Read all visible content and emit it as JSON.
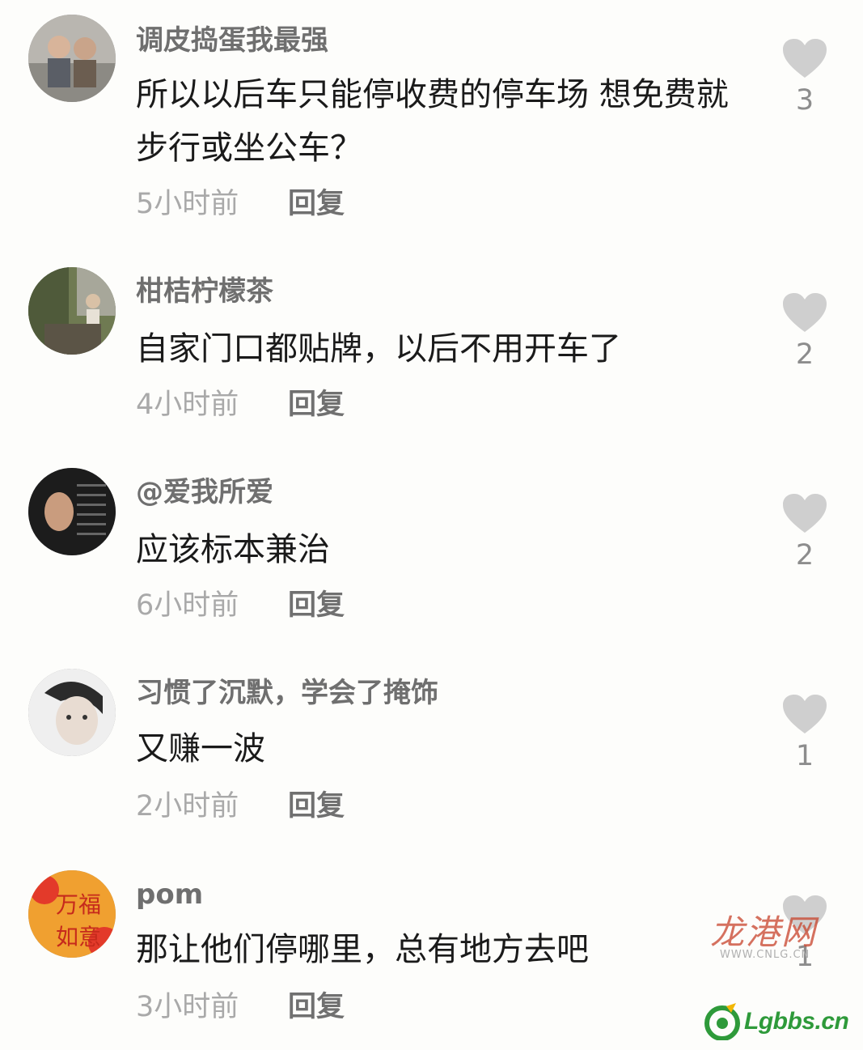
{
  "comments": [
    {
      "username": "调皮捣蛋我最强",
      "text": "所以以后车只能停收费的停车场 想免费就步行或坐公车？",
      "time": "5小时前",
      "reply": "回复",
      "likes": "3"
    },
    {
      "username": "柑桔柠檬茶",
      "text": "自家门口都贴牌，以后不用开车了",
      "time": "4小时前",
      "reply": "回复",
      "likes": "2"
    },
    {
      "username": "@爱我所爱",
      "text": "应该标本兼治",
      "time": "6小时前",
      "reply": "回复",
      "likes": "2"
    },
    {
      "username": "习惯了沉默，学会了掩饰",
      "text": "又赚一波",
      "time": "2小时前",
      "reply": "回复",
      "likes": "1"
    },
    {
      "username": "pom",
      "text": "那让他们停哪里，总有地方去吧",
      "time": "3小时前",
      "reply": "回复",
      "likes": "1"
    }
  ],
  "avatar_texts": {
    "line1": "万福",
    "line2": "如意"
  },
  "watermarks": {
    "logo_cn": "龙港网",
    "logo_url": "WWW.CNLG.CN",
    "lgbbs": "Lgbbs.cn"
  },
  "colors": {
    "heart": "#cfcfcf",
    "text": "#1a1a1a",
    "username": "#6f6f6f",
    "time": "#a9a9a9",
    "lgbbs_green": "#2e9a3a"
  }
}
